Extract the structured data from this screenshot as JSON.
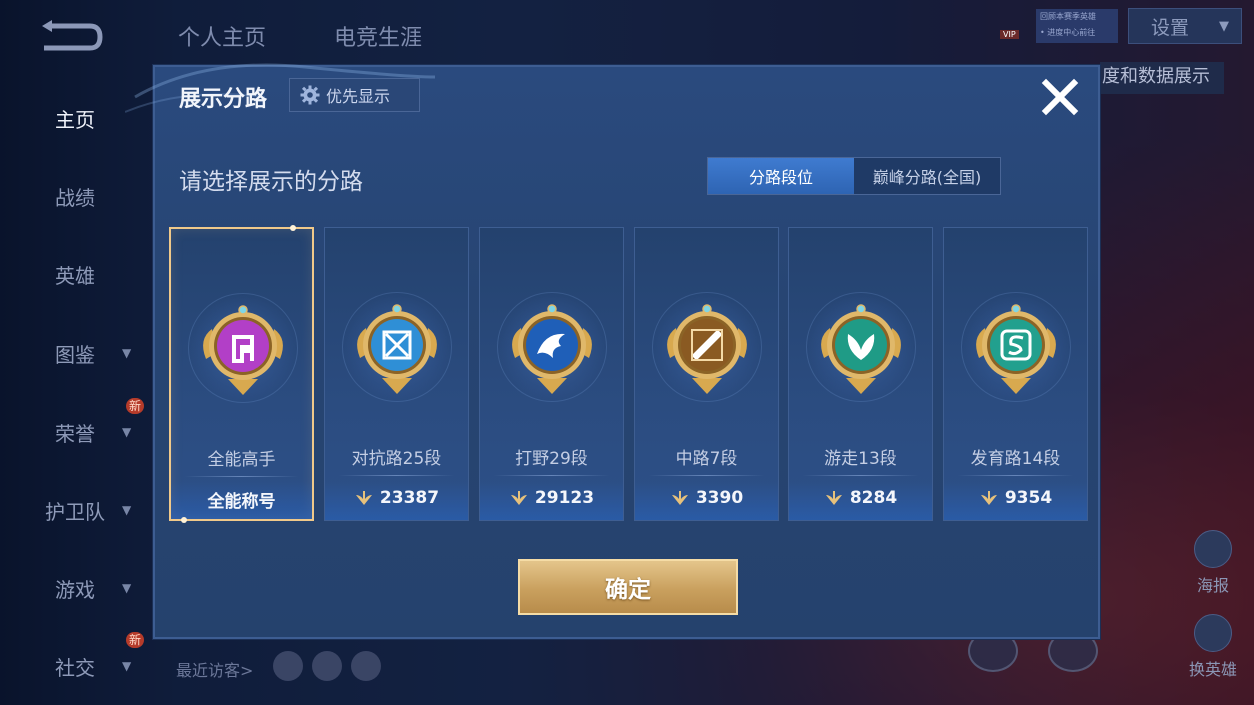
{
  "nav": {
    "top_tabs": [
      "个人主页",
      "电竞生涯"
    ],
    "settings_label": "设置",
    "behind_label": "度和数据展示",
    "mini_notice": [
      "回顾本赛季英雄",
      "• 进度中心前往"
    ],
    "vip_label": "VIP",
    "sidebar": [
      {
        "label": "主页",
        "active": true
      },
      {
        "label": "战绩"
      },
      {
        "label": "英雄"
      },
      {
        "label": "图鉴",
        "chevron": true
      },
      {
        "label": "荣誉",
        "chevron": true,
        "badge": "新"
      },
      {
        "label": "护卫队",
        "chevron": true
      },
      {
        "label": "游戏",
        "chevron": true
      },
      {
        "label": "社交",
        "chevron": true,
        "badge": "新"
      }
    ],
    "recent_visitors_label": "最近访客>",
    "right_actions": [
      "海报",
      "换英雄"
    ]
  },
  "modal": {
    "title": "展示分路",
    "priority_label": "优先显示",
    "subtitle": "请选择展示的分路",
    "segment": [
      "分路段位",
      "巅峰分路(全国)"
    ],
    "confirm_label": "确定",
    "cards": [
      {
        "name": "全能高手",
        "score": "全能称号",
        "color": "#b23fc7",
        "selected": true
      },
      {
        "name": "对抗路25段",
        "score": "23387",
        "color": "#2f8fd6"
      },
      {
        "name": "打野29段",
        "score": "29123",
        "color": "#1f5fb8"
      },
      {
        "name": "中路7段",
        "score": "3390",
        "color": "#8a5a22"
      },
      {
        "name": "游走13段",
        "score": "8284",
        "color": "#1f9b86"
      },
      {
        "name": "发育路14段",
        "score": "9354",
        "color": "#22a08e"
      }
    ]
  }
}
